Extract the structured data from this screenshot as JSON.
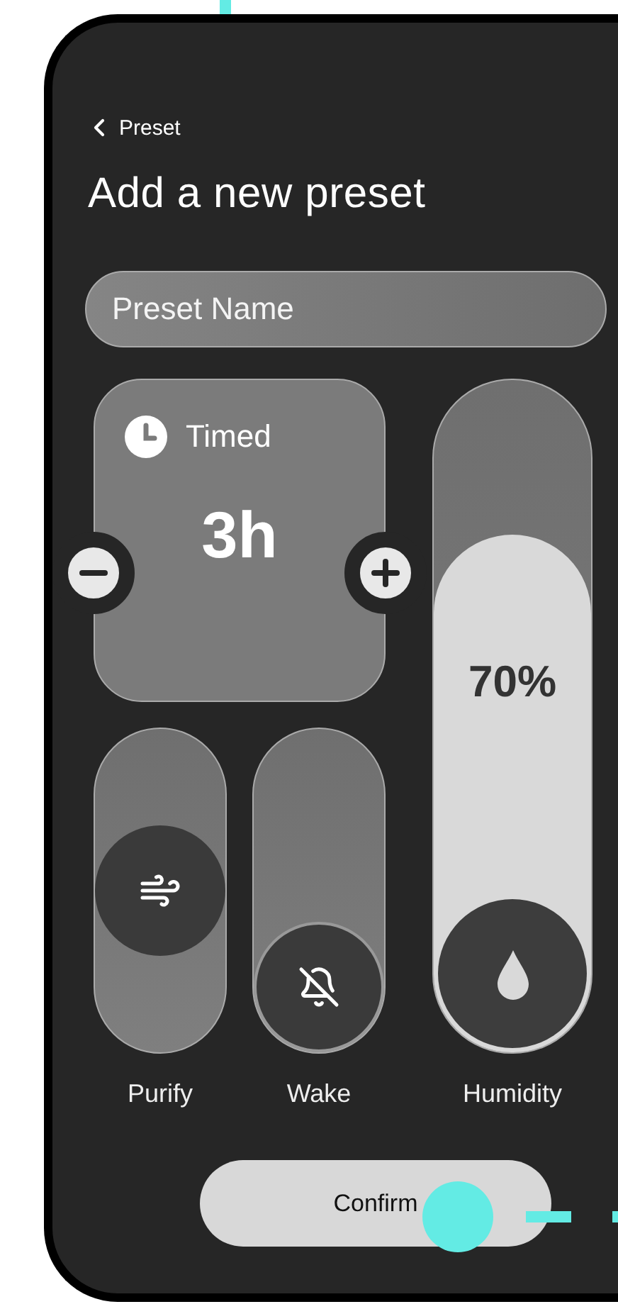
{
  "header": {
    "back_label": "Preset",
    "title": "Add a new preset"
  },
  "name_field": {
    "placeholder": "Preset Name"
  },
  "timer": {
    "label": "Timed",
    "value": "3h"
  },
  "toggles": [
    {
      "label": "Purify",
      "kind": "purify",
      "level": 0.5
    },
    {
      "label": "Wake",
      "kind": "wake",
      "level": 0
    }
  ],
  "humidity": {
    "label": "Humidity",
    "reading": "70%",
    "level": 0.77
  },
  "confirm": {
    "label": "Confirm"
  }
}
